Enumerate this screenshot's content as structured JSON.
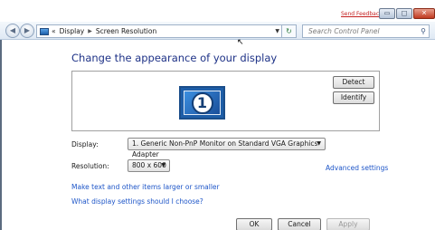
{
  "window": {
    "feedback_link": "Send Feedback",
    "minimize_glyph": "▭",
    "maximize_glyph": "□",
    "close_glyph": "✕"
  },
  "nav": {
    "back_glyph": "◀",
    "forward_glyph": "▶",
    "breadcrumb_prefix": "«",
    "breadcrumb": [
      "Display",
      "Screen Resolution"
    ],
    "breadcrumb_separator": "▶",
    "dropdown_glyph": "▼",
    "refresh_glyph": "↻",
    "search_placeholder": "Search Control Panel",
    "search_glyph": "⚲"
  },
  "main": {
    "heading": "Change the appearance of your display",
    "monitor_number": "1",
    "detect_label": "Detect",
    "identify_label": "Identify",
    "display_label": "Display:",
    "display_value": "1. Generic Non-PnP Monitor on Standard VGA Graphics Adapter",
    "resolution_label": "Resolution:",
    "resolution_value": "800 x 600",
    "advanced_settings": "Advanced settings",
    "link_text_size": "Make text and other items larger or smaller",
    "link_which_settings": "What display settings should I choose?"
  },
  "footer": {
    "ok_label": "OK",
    "cancel_label": "Cancel",
    "apply_label": "Apply"
  },
  "colors": {
    "heading": "#1e3287",
    "link": "#1e56c8",
    "feedback": "#c41f1f"
  }
}
